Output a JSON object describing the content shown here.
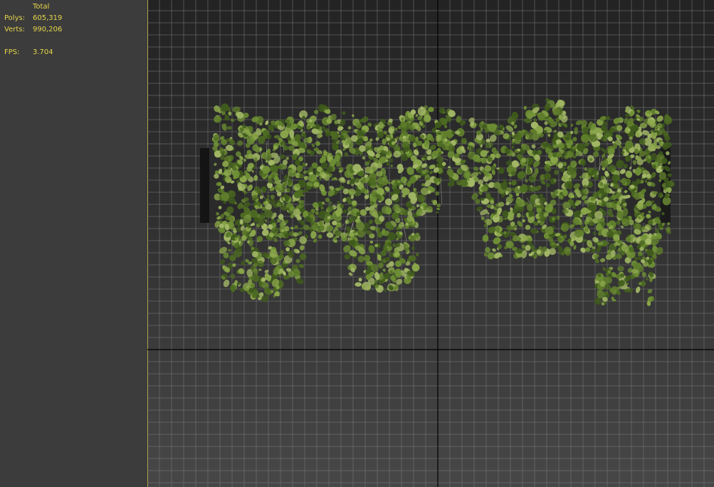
{
  "stats": {
    "total_label": "Total",
    "polys_label": "Polys:",
    "polys_value": "605,319",
    "verts_label": "Verts:",
    "verts_value": "990,206",
    "fps_label": "FPS:",
    "fps_value": "3.704"
  },
  "colors": {
    "stats_text": "#e6d64a",
    "grid_line": "#7a7a7a",
    "axis_line": "#000000",
    "viewport_border": "#c8b340",
    "foliage_dark": "#3f5a1c",
    "foliage_mid": "#5f7d2c",
    "foliage_light": "#8aa64a",
    "box": "#2a2a2a"
  },
  "viewport": {
    "view": "top",
    "objects": [
      "left-planter-box",
      "right-planter-box",
      "ivy-foliage"
    ]
  }
}
